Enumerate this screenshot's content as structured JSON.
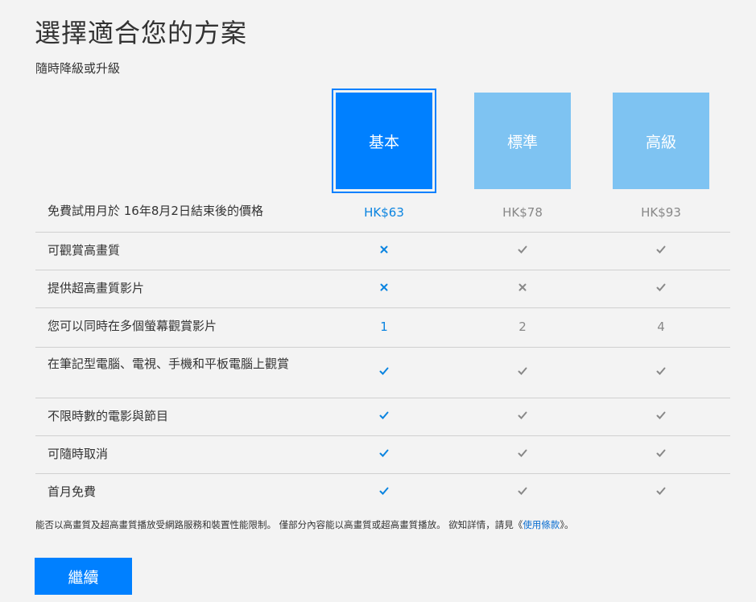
{
  "header": {
    "title": "選擇適合您的方案",
    "subtitle": "隨時降級或升級"
  },
  "plans": [
    {
      "name": "基本",
      "selected": true
    },
    {
      "name": "標準",
      "selected": false
    },
    {
      "name": "高級",
      "selected": false
    }
  ],
  "price_row": {
    "label": "免費試用月於 16年8月2日結束後的價格",
    "values": [
      "HK$63",
      "HK$78",
      "HK$93"
    ]
  },
  "feature_rows": [
    {
      "label": "可觀賞高畫質",
      "values": [
        "cross",
        "check",
        "check"
      ]
    },
    {
      "label": "提供超高畫質影片",
      "values": [
        "cross",
        "cross",
        "check"
      ]
    },
    {
      "label": "您可以同時在多個螢幕觀賞影片",
      "values": [
        "1",
        "2",
        "4"
      ]
    },
    {
      "label": "在筆記型電腦、電視、手機和平板電腦上觀賞",
      "values": [
        "check",
        "check",
        "check"
      ]
    },
    {
      "label": "不限時數的電影與節目",
      "values": [
        "check",
        "check",
        "check"
      ]
    },
    {
      "label": "可隨時取消",
      "values": [
        "check",
        "check",
        "check"
      ]
    },
    {
      "label": "首月免費",
      "values": [
        "check",
        "check",
        "check"
      ]
    }
  ],
  "footnote": {
    "text_before": "能否以高畫質及超高畫質播放受網路服務和裝置性能限制。 僅部分內容能以高畫質或超高畫質播放。 欲知詳情，請見《",
    "link": "使用條款",
    "text_after": "》。"
  },
  "actions": {
    "continue_label": "繼續"
  },
  "colors": {
    "selected_plan": "#0080ff",
    "unselected_plan": "#7ec3f2",
    "selected_value": "#0a84e0",
    "unselected_value": "#888888",
    "button": "#0080ff"
  }
}
